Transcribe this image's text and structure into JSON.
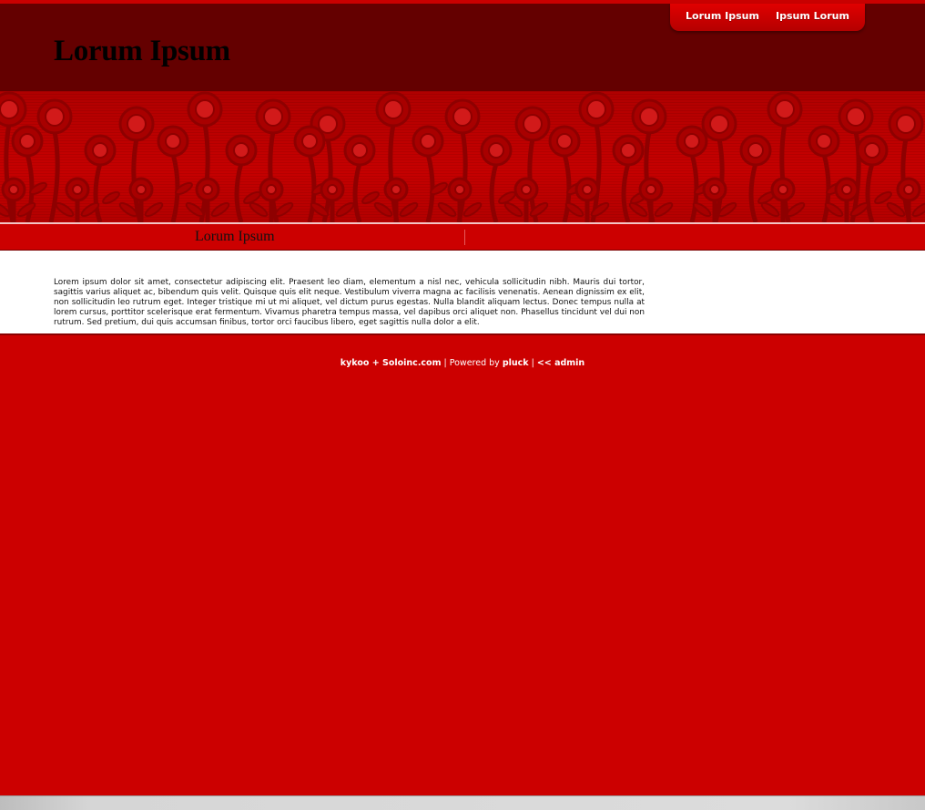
{
  "header": {
    "site_title": "Lorum Ipsum",
    "nav": [
      {
        "label": "Lorum Ipsum"
      },
      {
        "label": "Ipsum Lorum"
      }
    ]
  },
  "subbar": {
    "title": "Lorum Ipsum"
  },
  "content": {
    "paragraph": "Lorem ipsum dolor sit amet, consectetur adipiscing elit. Praesent leo diam, elementum a nisl nec, vehicula sollicitudin nibh. Mauris dui tortor, sagittis varius aliquet ac, bibendum quis velit. Quisque quis elit neque. Vestibulum viverra magna ac facilisis venenatis. Aenean dignissim ex elit, non sollicitudin leo rutrum eget. Integer tristique mi ut mi aliquet, vel dictum purus egestas. Nulla blandit aliquam lectus. Donec tempus nulla at lorem cursus, porttitor scelerisque erat fermentum. Vivamus pharetra tempus massa, vel dapibus orci aliquet non. Phasellus tincidunt vel dui non rutrum. Sed pretium, dui quis accumsan finibus, tortor orci faucibus libero, eget sagittis nulla dolor a elit."
  },
  "footer": {
    "kykoo": "kykoo",
    "plus": " + ",
    "soloinc": "Soloinc.com",
    "sep1": " | Powered by ",
    "pluck": "pluck",
    "sep2": " | ",
    "admin": "<< admin"
  },
  "colors": {
    "page_background": "#cc0000",
    "header_background": "#640000",
    "content_background": "#ffffff"
  }
}
